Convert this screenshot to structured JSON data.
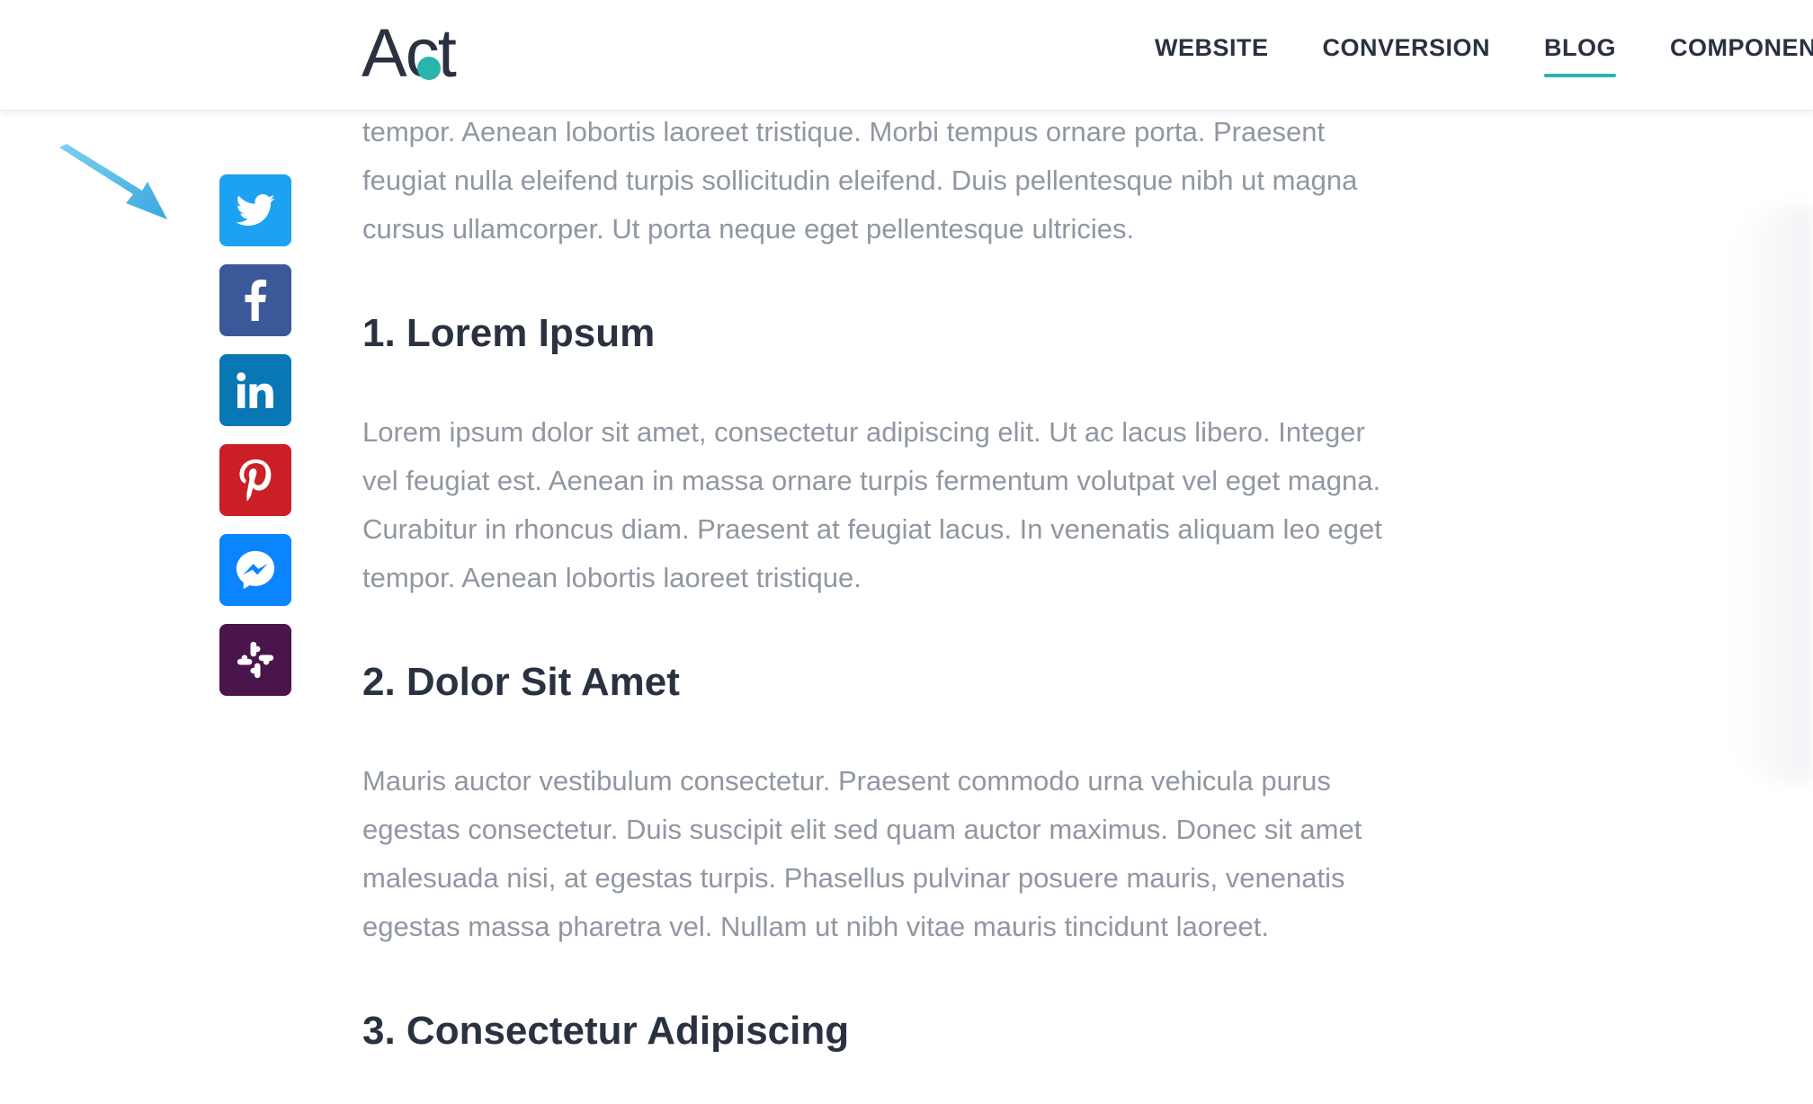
{
  "header": {
    "logo_text": "Act",
    "nav": [
      {
        "label": "WEBSITE",
        "active": false
      },
      {
        "label": "CONVERSION",
        "active": false
      },
      {
        "label": "BLOG",
        "active": true
      },
      {
        "label": "COMPONEN",
        "active": false
      }
    ]
  },
  "share": [
    {
      "network": "twitter",
      "icon": "twitter-icon",
      "color": "#1da1f2"
    },
    {
      "network": "facebook",
      "icon": "facebook-icon",
      "color": "#3b5998"
    },
    {
      "network": "linkedin",
      "icon": "linkedin-icon",
      "color": "#0a77b5"
    },
    {
      "network": "pinterest",
      "icon": "pinterest-icon",
      "color": "#cb2027"
    },
    {
      "network": "messenger",
      "icon": "messenger-icon",
      "color": "#0a84ff"
    },
    {
      "network": "slack",
      "icon": "slack-icon",
      "color": "#4a154b"
    }
  ],
  "article": {
    "intro_lines": [
      "tempor. Aenean lobortis laoreet tristique. Morbi tempus ornare porta. Praesent",
      "feugiat nulla eleifend turpis sollicitudin eleifend. Duis pellentesque nibh ut magna",
      "cursus ullamcorper. Ut porta neque eget pellentesque ultricies."
    ],
    "sections": [
      {
        "heading": "1. Lorem Ipsum",
        "lines": [
          "Lorem ipsum dolor sit amet, consectetur adipiscing elit. Ut ac lacus libero. Integer",
          "vel feugiat est. Aenean in massa ornare turpis fermentum volutpat vel eget magna.",
          "Curabitur in rhoncus diam. Praesent at feugiat lacus. In venenatis aliquam leo eget",
          "tempor. Aenean lobortis laoreet tristique."
        ]
      },
      {
        "heading": "2. Dolor Sit Amet",
        "lines": [
          "Mauris auctor vestibulum consectetur. Praesent commodo urna vehicula purus",
          "egestas consectetur. Duis suscipit elit sed quam auctor maximus. Donec sit amet",
          "malesuada nisi, at egestas turpis. Phasellus pulvinar posuere mauris, venenatis",
          "egestas massa pharetra vel. Nullam ut nibh vitae mauris tincidunt laoreet."
        ]
      },
      {
        "heading": "3. Consectetur Adipiscing",
        "lines": []
      }
    ]
  },
  "colors": {
    "accent": "#2ab5ac",
    "heading": "#2a3140",
    "body_text": "#9097a2",
    "annotation_arrow": "#4bb8e8"
  }
}
